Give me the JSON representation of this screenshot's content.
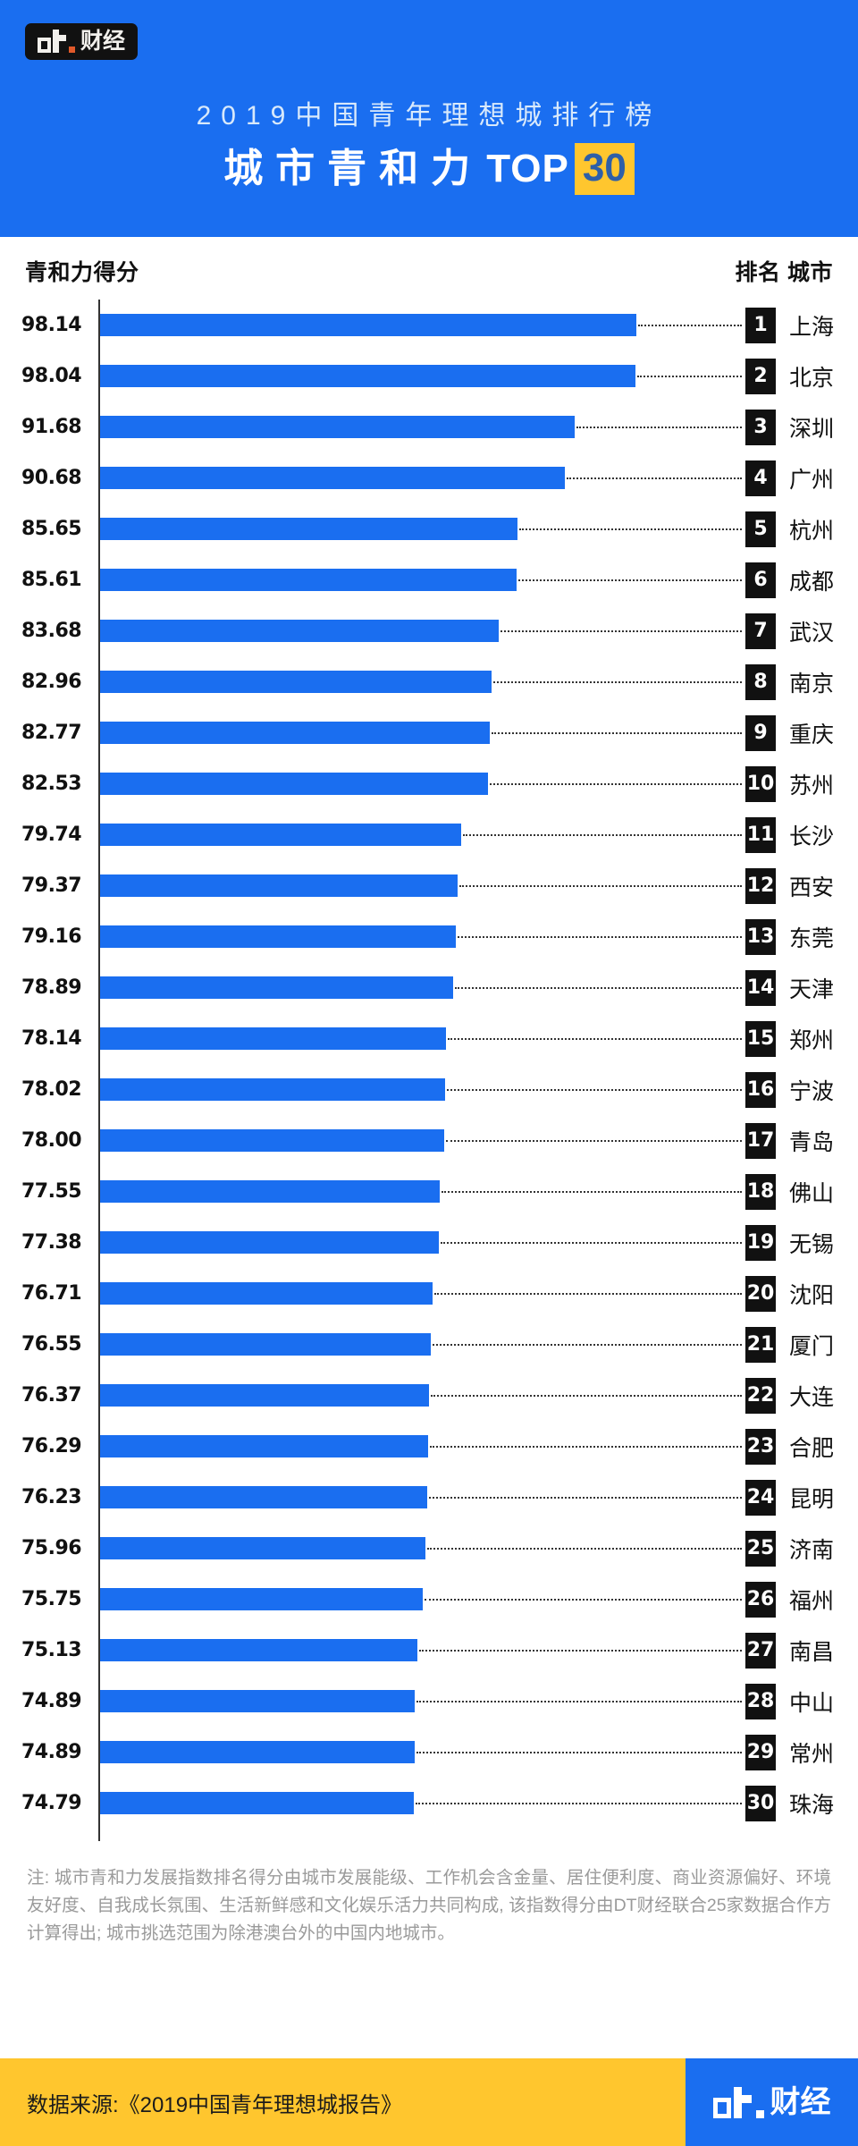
{
  "header": {
    "logo": {
      "mark": "dt",
      "cn": "财经"
    },
    "subtitle": "2019中国青年理想城排行榜",
    "title_cn": "城市青和力",
    "title_top": "TOP",
    "title_num": "30"
  },
  "columns": {
    "score_header": "青和力得分",
    "rank_city_header": "排名 城市"
  },
  "note": "注: 城市青和力发展指数排名得分由城市发展能级、工作机会含金量、居住便利度、商业资源偏好、环境友好度、自我成长氛围、生活新鲜感和文化娱乐活力共同构成, 该指数得分由DT财经联合25家数据合作方计算得出; 城市挑选范围为除港澳台外的中国内地城市。",
  "footer": {
    "source": "数据来源:《2019中国青年理想城报告》",
    "logo": {
      "mark": "dt",
      "cn": "财经"
    }
  },
  "colors": {
    "brand_blue": "#1a6ef0",
    "accent_yellow": "#ffc62e",
    "badge_black": "#111111",
    "note_gray": "#9a9a9a",
    "subtitle_blue": "#d8e9fb",
    "num_blue": "#2e5fa8"
  },
  "chart_data": {
    "type": "bar",
    "orientation": "horizontal",
    "title": "城市青和力 TOP30",
    "subtitle": "2019中国青年理想城排行榜",
    "xlabel": "",
    "ylabel": "青和力得分",
    "grid": false,
    "legend": "none",
    "xlim": [
      0,
      98.14
    ],
    "value_label_format": "0.00",
    "categories": [
      "上海",
      "北京",
      "深圳",
      "广州",
      "杭州",
      "成都",
      "武汉",
      "南京",
      "重庆",
      "苏州",
      "长沙",
      "西安",
      "东莞",
      "天津",
      "郑州",
      "宁波",
      "青岛",
      "佛山",
      "无锡",
      "沈阳",
      "厦门",
      "大连",
      "合肥",
      "昆明",
      "济南",
      "福州",
      "南昌",
      "中山",
      "常州",
      "珠海"
    ],
    "values": [
      98.14,
      98.04,
      91.68,
      90.68,
      85.65,
      85.61,
      83.68,
      82.96,
      82.77,
      82.53,
      79.74,
      79.37,
      79.16,
      78.89,
      78.14,
      78.02,
      78.0,
      77.55,
      77.38,
      76.71,
      76.55,
      76.37,
      76.29,
      76.23,
      75.96,
      75.75,
      75.13,
      74.89,
      74.89,
      74.79
    ],
    "rows": [
      {
        "rank": "1",
        "city": "上海",
        "score": "98.14",
        "value": 98.14
      },
      {
        "rank": "2",
        "city": "北京",
        "score": "98.04",
        "value": 98.04
      },
      {
        "rank": "3",
        "city": "深圳",
        "score": "91.68",
        "value": 91.68
      },
      {
        "rank": "4",
        "city": "广州",
        "score": "90.68",
        "value": 90.68
      },
      {
        "rank": "5",
        "city": "杭州",
        "score": "85.65",
        "value": 85.65
      },
      {
        "rank": "6",
        "city": "成都",
        "score": "85.61",
        "value": 85.61
      },
      {
        "rank": "7",
        "city": "武汉",
        "score": "83.68",
        "value": 83.68
      },
      {
        "rank": "8",
        "city": "南京",
        "score": "82.96",
        "value": 82.96
      },
      {
        "rank": "9",
        "city": "重庆",
        "score": "82.77",
        "value": 82.77
      },
      {
        "rank": "10",
        "city": "苏州",
        "score": "82.53",
        "value": 82.53
      },
      {
        "rank": "11",
        "city": "长沙",
        "score": "79.74",
        "value": 79.74
      },
      {
        "rank": "12",
        "city": "西安",
        "score": "79.37",
        "value": 79.37
      },
      {
        "rank": "13",
        "city": "东莞",
        "score": "79.16",
        "value": 79.16
      },
      {
        "rank": "14",
        "city": "天津",
        "score": "78.89",
        "value": 78.89
      },
      {
        "rank": "15",
        "city": "郑州",
        "score": "78.14",
        "value": 78.14
      },
      {
        "rank": "16",
        "city": "宁波",
        "score": "78.02",
        "value": 78.02
      },
      {
        "rank": "17",
        "city": "青岛",
        "score": "78.00",
        "value": 78.0
      },
      {
        "rank": "18",
        "city": "佛山",
        "score": "77.55",
        "value": 77.55
      },
      {
        "rank": "19",
        "city": "无锡",
        "score": "77.38",
        "value": 77.38
      },
      {
        "rank": "20",
        "city": "沈阳",
        "score": "76.71",
        "value": 76.71
      },
      {
        "rank": "21",
        "city": "厦门",
        "score": "76.55",
        "value": 76.55
      },
      {
        "rank": "22",
        "city": "大连",
        "score": "76.37",
        "value": 76.37
      },
      {
        "rank": "23",
        "city": "合肥",
        "score": "76.29",
        "value": 76.29
      },
      {
        "rank": "24",
        "city": "昆明",
        "score": "76.23",
        "value": 76.23
      },
      {
        "rank": "25",
        "city": "济南",
        "score": "75.96",
        "value": 75.96
      },
      {
        "rank": "26",
        "city": "福州",
        "score": "75.75",
        "value": 75.75
      },
      {
        "rank": "27",
        "city": "南昌",
        "score": "75.13",
        "value": 75.13
      },
      {
        "rank": "28",
        "city": "中山",
        "score": "74.89",
        "value": 74.89
      },
      {
        "rank": "29",
        "city": "常州",
        "score": "74.89",
        "value": 74.89
      },
      {
        "rank": "30",
        "city": "珠海",
        "score": "74.79",
        "value": 74.79
      }
    ]
  }
}
